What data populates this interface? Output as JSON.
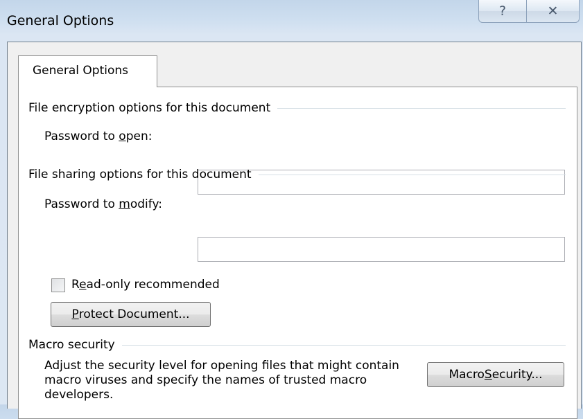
{
  "window": {
    "title": "General Options",
    "help_glyph": "?",
    "close_glyph": "✕"
  },
  "tab": {
    "label": "General Options"
  },
  "encryption": {
    "group_label": "File encryption options for this document",
    "password_open_label_pre": "Password to ",
    "password_open_label_ul": "o",
    "password_open_label_post": "pen:",
    "password_open_value": ""
  },
  "sharing": {
    "group_label": "File sharing options for this document",
    "password_modify_label_pre": "Password to ",
    "password_modify_label_ul": "m",
    "password_modify_label_post": "odify:",
    "password_modify_value": "",
    "readonly_pre": "R",
    "readonly_ul": "e",
    "readonly_post": "ad-only recommended",
    "readonly_checked": false,
    "protect_ul": "P",
    "protect_post": "rotect Document..."
  },
  "macro": {
    "group_label": "Macro security",
    "description": "Adjust the security level for opening files that might contain macro viruses and specify the names of trusted macro developers.",
    "button_pre": "Macro ",
    "button_ul": "S",
    "button_post": "ecurity..."
  }
}
